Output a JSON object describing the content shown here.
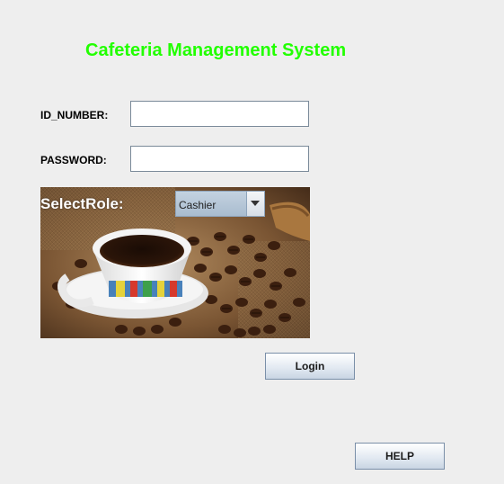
{
  "app": {
    "title": "Cafeteria Management System",
    "title_color": "#22ff00"
  },
  "form": {
    "id_label": "ID_NUMBER:",
    "id_value": "",
    "password_label": "PASSWORD:",
    "password_value": "",
    "role_label": "SelectRole:",
    "role_selected": "Cashier"
  },
  "image": {
    "subject": "coffee-cup-and-beans-photo"
  },
  "buttons": {
    "login_label": "Login",
    "help_label": "HELP"
  },
  "icons": {
    "dropdown": "chevron-down-icon"
  }
}
